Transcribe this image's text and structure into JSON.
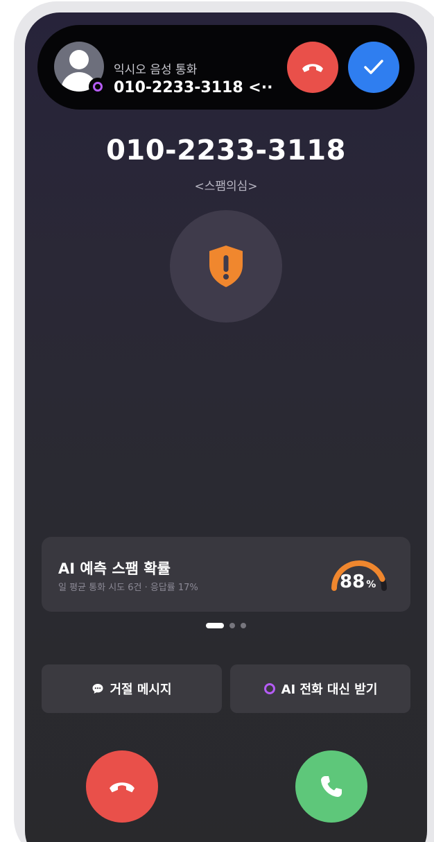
{
  "banner": {
    "label": "익시오 음성 통화",
    "number": "010-2233-3118 <···",
    "decline_icon": "phone-hangup-icon",
    "accept_icon": "checkmark-icon"
  },
  "caller": {
    "number": "010-2233-3118",
    "tag": "<스팸의심>",
    "icon": "warning-shield-icon"
  },
  "ai_card": {
    "title": "AI 예측 스팸 확률",
    "subtitle": "일 평균 통화 시도 6건 · 응답률 17%",
    "probability": 88,
    "unit": "%"
  },
  "pager": {
    "pages": 3,
    "active": 0
  },
  "actions": {
    "reject_message": "거절 메시지",
    "ai_answer": "AI 전화 대신 받기"
  },
  "call_controls": {
    "decline_icon": "phone-hangup-icon",
    "accept_icon": "phone-icon"
  },
  "colors": {
    "decline": "#e9504a",
    "accept_blue": "#2f7ef0",
    "accept_green": "#5ec77a",
    "warning": "#f0872e",
    "ai_purple": "#b55cf5"
  }
}
